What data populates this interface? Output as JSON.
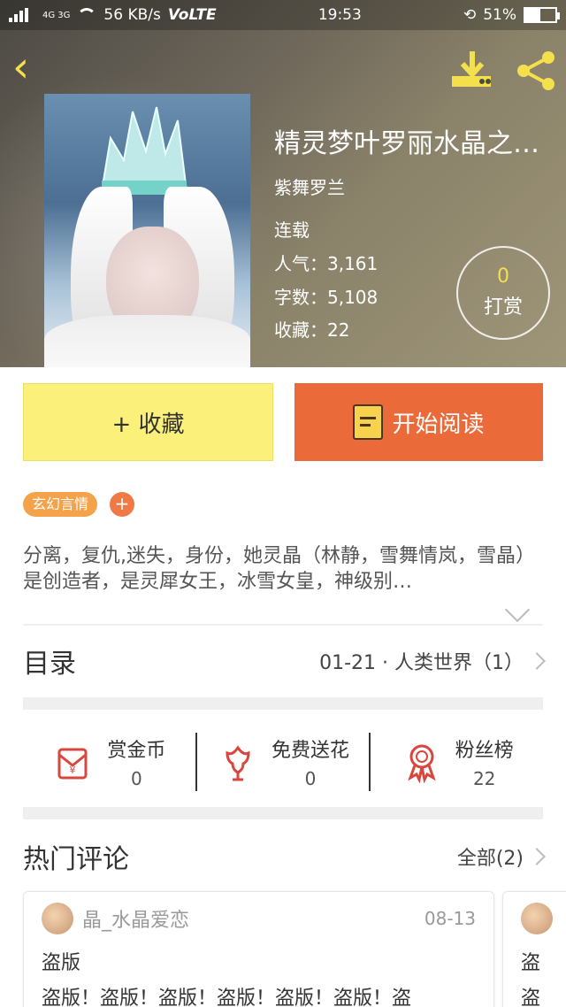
{
  "status_bar": {
    "network": "4G 3G",
    "speed": "56 KB/s",
    "volte": "VoLTE",
    "time": "19:53",
    "battery_percent": "51%",
    "battery_level": 0.51
  },
  "hero": {
    "title": "精灵梦叶罗丽水晶之…",
    "author": "紫舞罗兰",
    "status": "连载",
    "popularity_label": "人气：",
    "popularity_value": "3,161",
    "words_label": "字数：",
    "words_value": "5,108",
    "favorites_label": "收藏：",
    "favorites_value": "22",
    "tip_count": "0",
    "tip_label": "打赏"
  },
  "actions": {
    "favorite_label": "+ 收藏",
    "read_label": "开始阅读"
  },
  "tags": {
    "category": "玄幻言情",
    "add": "+"
  },
  "description": "分离，复仇,迷失，身份，她灵晶（林静，雪舞情岚，雪晶）是创造者，是灵犀女王，冰雪女皇，神级别…",
  "catalog": {
    "title": "目录",
    "latest": "01-21 · 人类世界（1）"
  },
  "rewards": [
    {
      "label": "赏金币",
      "value": "0"
    },
    {
      "label": "免费送花",
      "value": "0"
    },
    {
      "label": "粉丝榜",
      "value": "22"
    }
  ],
  "comments": {
    "title": "热门评论",
    "all_label": "全部(2)",
    "items": [
      {
        "user": "晶_水晶爱恋",
        "date": "08-13",
        "title": "盗版",
        "body": "盗版！盗版！盗版！盗版！盗版！盗版！盗"
      },
      {
        "title": "盗",
        "body": "盗"
      }
    ]
  },
  "colors": {
    "accent_yellow": "#f4e04d",
    "favorite_button": "#fbf07a",
    "read_button": "#eb6a3a",
    "tag": "#f4a34a"
  }
}
